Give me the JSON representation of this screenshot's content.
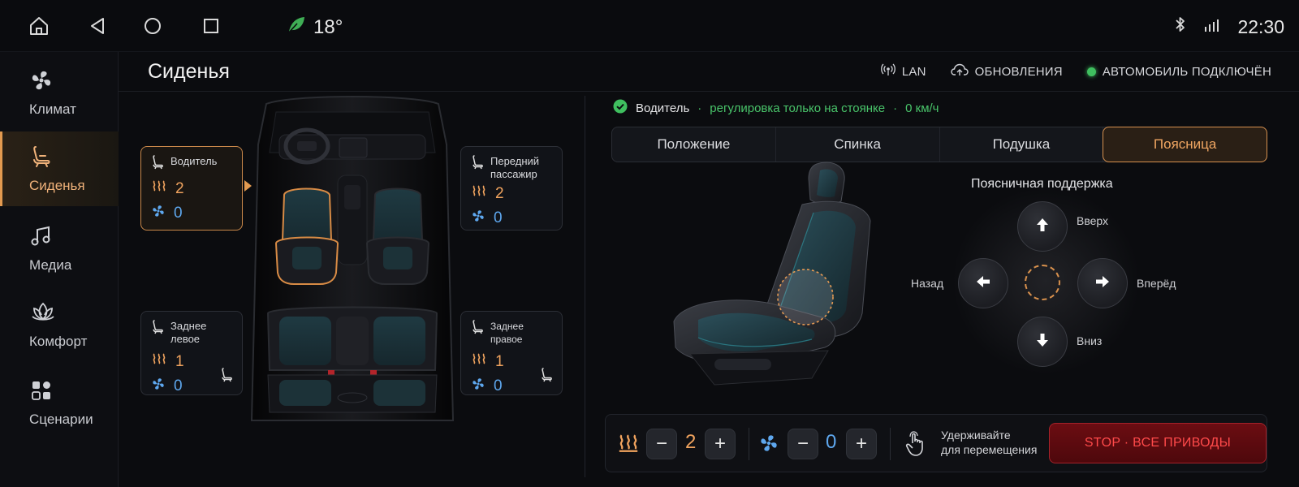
{
  "status_bar": {
    "temperature": "18°",
    "time": "22:30",
    "icons": [
      "home-icon",
      "back-icon",
      "circle-home-icon",
      "recent-apps-icon",
      "leaf-icon",
      "bluetooth-icon",
      "signal-icon"
    ]
  },
  "sidebar": {
    "items": [
      {
        "label": "Климат",
        "icon": "fan-icon"
      },
      {
        "label": "Сиденья",
        "icon": "seat-icon"
      },
      {
        "label": "Медиа",
        "icon": "music-note-icon"
      },
      {
        "label": "Комфорт",
        "icon": "lotus-icon"
      },
      {
        "label": "Сценарии",
        "icon": "scenarios-icon"
      }
    ],
    "active_index": 1
  },
  "header": {
    "title": "Сиденья",
    "lan": "LAN",
    "updates": "ОБНОВЛЕНИЯ",
    "car_status": "АВТОМОБИЛЬ ПОДКЛЮЧЁН"
  },
  "seats": {
    "driver": {
      "name": "Водитель",
      "heat": "2",
      "vent": "0"
    },
    "front_passenger": {
      "name_line1": "Передний",
      "name_line2": "пассажир",
      "heat": "2",
      "vent": "0"
    },
    "rear_left": {
      "name": "Заднее левое",
      "heat": "1",
      "vent": "0"
    },
    "rear_right": {
      "name": "Заднее правое",
      "heat": "1",
      "vent": "0"
    }
  },
  "driver_status": {
    "name": "Водитель",
    "note": "регулировка только на стоянке",
    "speed": "0 км/ч",
    "separator": "·"
  },
  "tabs": [
    {
      "label": "Положение"
    },
    {
      "label": "Спинка"
    },
    {
      "label": "Подушка"
    },
    {
      "label": "Поясница"
    }
  ],
  "active_tab": 3,
  "lumbar": {
    "title": "Поясничная поддержка",
    "up": "Вверх",
    "down": "Вниз",
    "back": "Назад",
    "forward": "Вперёд"
  },
  "bottom": {
    "heat_value": "2",
    "vent_value": "0",
    "minus": "−",
    "plus": "+",
    "hold_line1": "Удерживайте",
    "hold_line2": "для перемещения",
    "stop": "STOP · ВСЕ ПРИВОДЫ"
  },
  "colors": {
    "accent": "#e39a50",
    "heat": "#f0a35e",
    "vent": "#5ea7ee",
    "ok": "#49c46a",
    "stop": "#ff4a4a"
  }
}
